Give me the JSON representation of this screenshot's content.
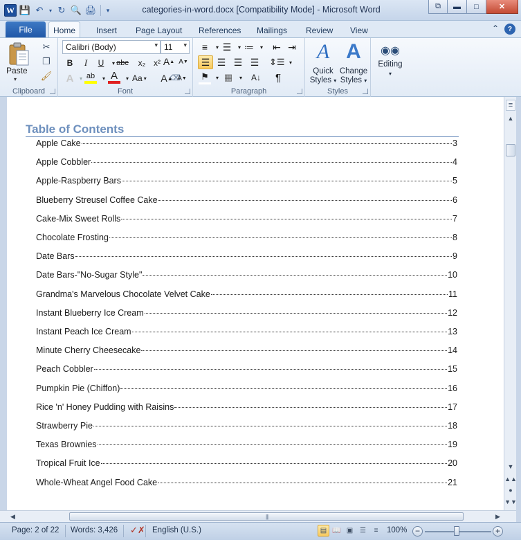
{
  "window": {
    "title": "categories-in-word.docx [Compatibility Mode]  -  Microsoft Word",
    "app_logo": "W"
  },
  "ribbon_tabs": {
    "file": "File",
    "home": "Home",
    "insert": "Insert",
    "page_layout": "Page Layout",
    "references": "References",
    "mailings": "Mailings",
    "review": "Review",
    "view": "View"
  },
  "clipboard": {
    "paste_label": "Paste",
    "group_label": "Clipboard"
  },
  "font": {
    "font_name": "Calibri (Body)",
    "font_size": "11",
    "group_label": "Font",
    "bold": "B",
    "italic": "I",
    "underline": "U",
    "strikethrough": "abc",
    "subscript": "x₂",
    "superscript": "x²",
    "change_case": "Aa",
    "grow": "A",
    "shrink": "A"
  },
  "paragraph": {
    "group_label": "Paragraph",
    "pilcrow": "¶"
  },
  "styles": {
    "quick_styles_line1": "Quick",
    "quick_styles_line2": "Styles",
    "change_styles_line1": "Change",
    "change_styles_line2": "Styles",
    "group_label": "Styles"
  },
  "editing": {
    "label": "Editing"
  },
  "document": {
    "toc_title": "Table of Contents",
    "entries": [
      {
        "title": "Apple Cake",
        "page": "3"
      },
      {
        "title": "Apple Cobbler",
        "page": "4"
      },
      {
        "title": "Apple-Raspberry Bars",
        "page": "5"
      },
      {
        "title": "Blueberry Streusel Coffee Cake",
        "page": "6"
      },
      {
        "title": "Cake-Mix Sweet Rolls",
        "page": "7"
      },
      {
        "title": "Chocolate Frosting",
        "page": "8"
      },
      {
        "title": "Date Bars",
        "page": "9"
      },
      {
        "title": "Date Bars-\"No-Sugar Style\"",
        "page": "10"
      },
      {
        "title": "Grandma's Marvelous Chocolate Velvet Cake",
        "page": "11"
      },
      {
        "title": "Instant Blueberry Ice Cream",
        "page": "12"
      },
      {
        "title": "Instant Peach Ice Cream",
        "page": "13"
      },
      {
        "title": "Minute Cherry Cheesecake",
        "page": "14"
      },
      {
        "title": "Peach Cobbler",
        "page": "15"
      },
      {
        "title": "Pumpkin Pie (Chiffon)",
        "page": "16"
      },
      {
        "title": "Rice 'n' Honey Pudding with Raisins",
        "page": "17"
      },
      {
        "title": "Strawberry Pie",
        "page": "18"
      },
      {
        "title": "Texas Brownies",
        "page": "19"
      },
      {
        "title": "Tropical Fruit Ice",
        "page": "20"
      },
      {
        "title": "Whole-Wheat Angel Food Cake",
        "page": "21"
      }
    ]
  },
  "status": {
    "page": "Page: 2 of 22",
    "words": "Words: 3,426",
    "language": "English (U.S.)",
    "zoom": "100%"
  },
  "colors": {
    "heading": "#6d8fbd",
    "file_tab": "#2b62b0",
    "close_button": "#c44a33"
  }
}
